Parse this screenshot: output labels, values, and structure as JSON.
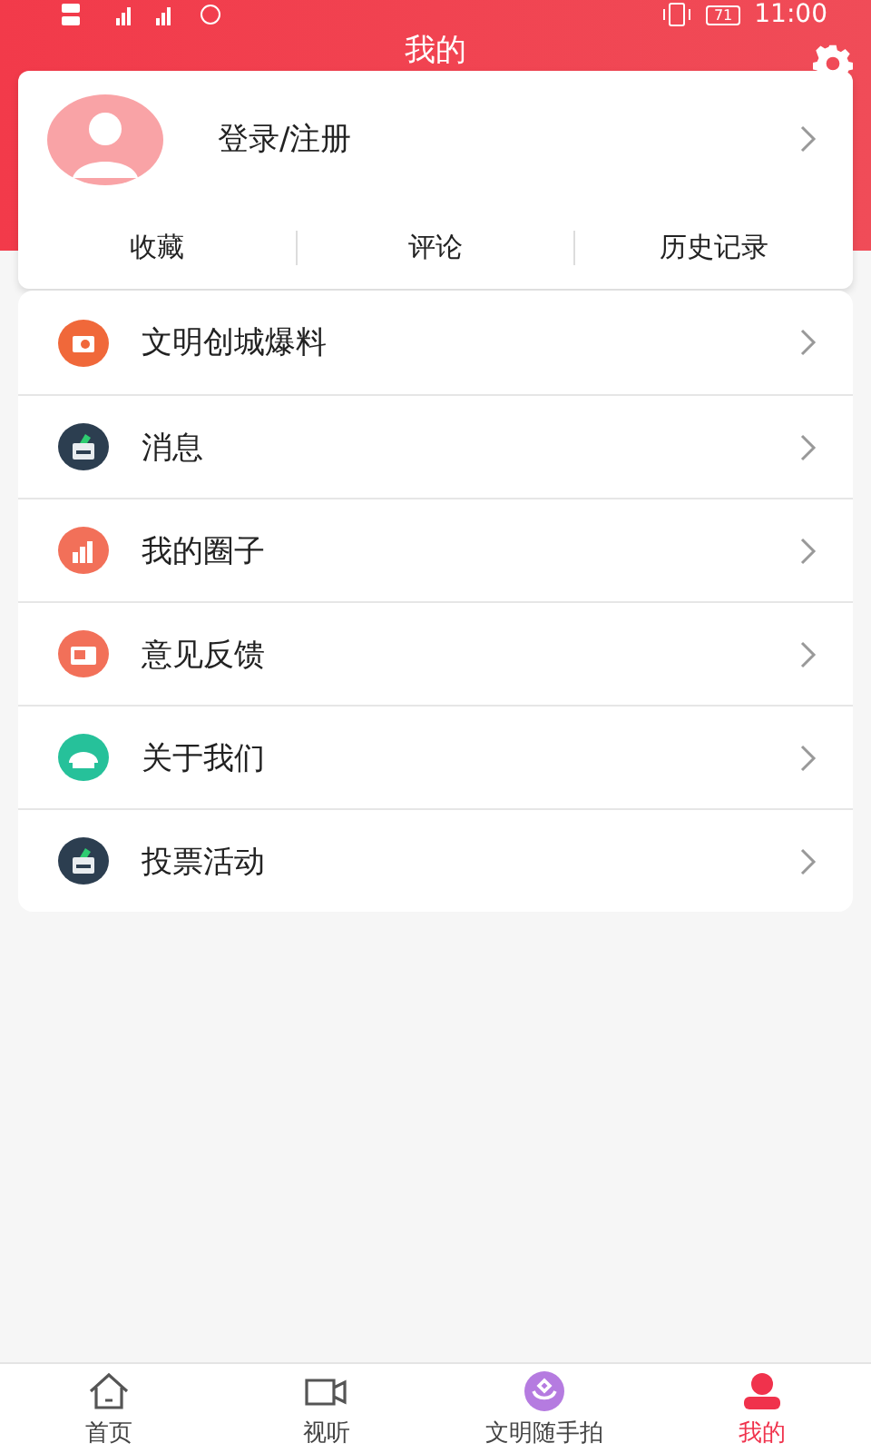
{
  "status_bar": {
    "battery": "71",
    "time": "11:00"
  },
  "header": {
    "title": "我的"
  },
  "profile": {
    "login": "登录/注册"
  },
  "shortcuts": [
    "收藏",
    "评论",
    "历史记录"
  ],
  "menu": [
    {
      "label": "文明创城爆料",
      "kind": "camera",
      "color": "#f0683a"
    },
    {
      "label": "消息",
      "kind": "ballot",
      "color": "#2c3e50"
    },
    {
      "label": "我的圈子",
      "kind": "chart",
      "color": "#f27059"
    },
    {
      "label": "意见反馈",
      "kind": "news",
      "color": "#f27059"
    },
    {
      "label": "关于我们",
      "kind": "bus",
      "color": "#26c19a"
    },
    {
      "label": "投票活动",
      "kind": "ballot",
      "color": "#2c3e50"
    }
  ],
  "tabbar": [
    {
      "label": "首页",
      "kind": "home",
      "selected": false
    },
    {
      "label": "视听",
      "kind": "video",
      "selected": false
    },
    {
      "label": "文明随手拍",
      "kind": "hands",
      "selected": false
    },
    {
      "label": "我的",
      "kind": "person",
      "selected": true
    }
  ]
}
